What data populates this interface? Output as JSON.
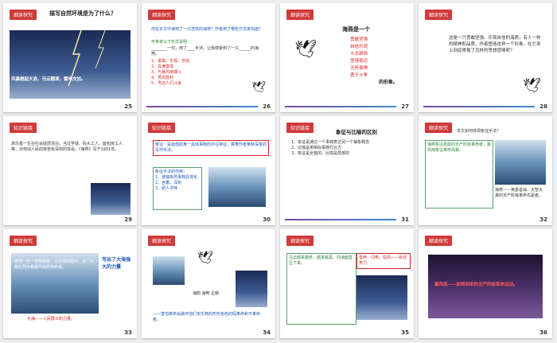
{
  "slides": [
    {
      "num": "25",
      "tag": "细读探究",
      "title": "描写自然环境是为了什么？",
      "caption": "风暴掀起大浪，乌云翻滚，雷电交加。"
    },
    {
      "num": "26",
      "tag": "细读探究",
      "q": "你在本文中读到了一只怎样的海燕？作者用了哪些方法来刻画？",
      "hint": "可参考以下形式说明：",
      "fill": "________一句，用了____手法，让我感受到了一只______的海燕。",
      "list": [
        "1、勇敢、乐观、自信",
        "2、充满激情",
        "3、与暴风雨搏斗",
        "4、预见胜利",
        "5、号召人们斗争"
      ]
    },
    {
      "num": "27",
      "tag": "细读探究",
      "head": "海燕是一个",
      "traits": [
        "勇敢坚强",
        "自信乐观",
        "斗志昂扬",
        "坚强豪迈",
        "无所畏惧",
        "勇于斗争"
      ],
      "tail": "的形象。"
    },
    {
      "num": "28",
      "tag": "细读探究",
      "text": "这是一只勇敢坚强、乐观自信的海燕，有人一样的精神和品质，作者塑造这样一个形象，在它身上到底寄寓了怎样的思想感情呢？"
    },
    {
      "num": "29",
      "tag": "知识链接",
      "text": "高尔基一生在社会底层漂泊，当过学徒、码头工人、面包房工人等，对劳动人民的疾苦有深刻的体会。《海燕》写于1901年。"
    },
    {
      "num": "30",
      "tag": "知识链接",
      "def": "象征：是指借助某一具体事物的外在特征，寄寓作者某种深意的写作手法。",
      "lead": "象征手法的作用：",
      "items": [
        "1、使抽象的事物具体化",
        "2、含蓄、深刻",
        "3、耐人寻味"
      ]
    },
    {
      "num": "31",
      "tag": "知识链接",
      "title": "象征与比喻的区别",
      "points": [
        "1、象征是通过一个事物表达另一个抽象概念",
        "2、比喻是用相似事物打比方",
        "3、象征是全篇的，比喻是局部的"
      ]
    },
    {
      "num": "32",
      "tag": "细读探究",
      "q": "本文如何体现象征手法？",
      "body": "海燕象征勇敢的无产阶级革命者，暴风雨象征革命风暴。",
      "highlight": "海燕——英勇善战、大智大勇的无产阶级革命先驱者。"
    },
    {
      "num": "33",
      "tag": "细读探究",
      "text": "波涛一些一些地跳着，在无情的吼叫，这一切都在预示着暴风雨即将到来。",
      "side": "写出了大海强大的力量",
      "red": "大海——人民群众的力量。"
    },
    {
      "num": "34",
      "tag": "细读探究",
      "labels": "海鸥  海鸭  企鹅",
      "bottom": "——害怕革命会破坏他们安乐窝的形形色色的假革命和不革命者。"
    },
    {
      "num": "35",
      "tag": "细读探究",
      "text": "乌云越来越低，越来越黑，向海面直压下来。",
      "callout": "雷声、闪电、狂风——反动势力"
    },
    {
      "num": "36",
      "tag": "细读探究",
      "text": "暴风雨——即将到来的无产阶级革命运动。"
    }
  ]
}
